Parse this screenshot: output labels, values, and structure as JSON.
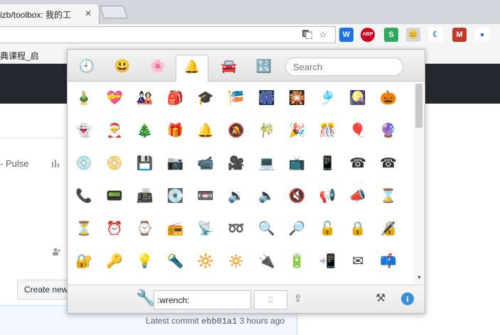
{
  "browser": {
    "tab_title": "izb/toolbox: 我的工",
    "tab_close": "✕",
    "bookmark_label": "典课程_启",
    "omnibox_icons": [
      "translate-icon",
      "star-icon"
    ],
    "extensions": [
      {
        "name": "w-extension-icon",
        "label": "W",
        "color": "#1a73e8"
      },
      {
        "name": "adblock-plus-icon",
        "label": "ABP",
        "color": "#d0021b"
      },
      {
        "name": "s-extension-icon",
        "label": "S",
        "color": "#2eaa5c"
      },
      {
        "name": "emoji-extension-icon",
        "label": "😊",
        "color": "#d6d6d6"
      },
      {
        "name": "crescent-extension-icon",
        "label": "☾",
        "color": "#ffffff"
      },
      {
        "name": "m-extension-icon",
        "label": "M",
        "color": "#c0392b"
      },
      {
        "name": "globe-extension-icon",
        "label": "●",
        "color": "#ffffff"
      }
    ]
  },
  "page": {
    "pulse_label": "- Pulse",
    "create_button_label": "Create new",
    "commit_label": "Latest commit",
    "commit_sha": "ebb01a1",
    "commit_time": "3 hours ago"
  },
  "emoji_picker": {
    "categories": [
      {
        "name": "clock-category-icon",
        "glyph": "🕘",
        "active": false
      },
      {
        "name": "smiley-category-icon",
        "glyph": "😃",
        "active": false
      },
      {
        "name": "flower-category-icon",
        "glyph": "🌸",
        "active": false
      },
      {
        "name": "bell-category-icon",
        "glyph": "🔔",
        "active": true
      },
      {
        "name": "car-category-icon",
        "glyph": "🚘",
        "active": false
      },
      {
        "name": "symbols-category-icon",
        "glyph": "🔣",
        "active": false
      }
    ],
    "search_placeholder": "Search",
    "rows": [
      [
        "🎍",
        "💝",
        "🎎",
        "🎒",
        "🎓",
        "🎏",
        "🎆",
        "🎇",
        "🎐",
        "🎑",
        "🎃"
      ],
      [
        "👻",
        "🎅",
        "🎄",
        "🎁",
        "🔔",
        "🔕",
        "🎋",
        "🎉",
        "🎊",
        "🎈",
        "🔮"
      ],
      [
        "💿",
        "📀",
        "💾",
        "📷",
        "📹",
        "🎥",
        "💻",
        "📺",
        "📱",
        "☎",
        "☎"
      ],
      [
        "📞",
        "📟",
        "📠",
        "💽",
        "📼",
        "🔉",
        "🔈",
        "🔇",
        "📢",
        "📣",
        "⌛"
      ],
      [
        "⏳",
        "⏰",
        "⌚",
        "📻",
        "📡",
        "➿",
        "🔍",
        "🔎",
        "🔓",
        "🔒",
        "🔏"
      ],
      [
        "🔐",
        "🔑",
        "💡",
        "🔦",
        "🔆",
        "🔅",
        "🔌",
        "🔋",
        "📲",
        "✉",
        "📫"
      ]
    ],
    "footer": {
      "preview_icon": "wrench-icon",
      "code_value": ":wrench:",
      "copy_glyph": "▯",
      "share_glyph": "⇪",
      "tools_glyph": "⚒",
      "info_glyph": "i"
    }
  }
}
